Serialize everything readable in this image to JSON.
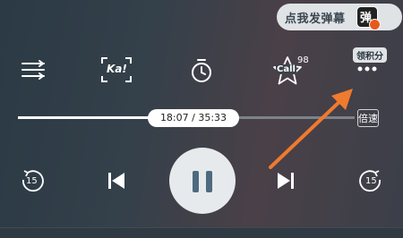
{
  "danmaku": {
    "prompt": "点我发弹幕",
    "toggle_char": "弹"
  },
  "toolbar": {
    "karaoke_label": "Ka!",
    "call_label": "Call",
    "call_count": "98",
    "points_label": "领积分"
  },
  "progress": {
    "time_text": "18:07 / 35:33",
    "fraction": 0.51,
    "speed_label": "倍速"
  },
  "controls": {
    "rewind_seconds": "15",
    "forward_seconds": "15"
  },
  "colors": {
    "accent_orange": "#f07a2e",
    "pause_icon": "#4d6a7f",
    "pill_bg": "#dfe3e6"
  }
}
